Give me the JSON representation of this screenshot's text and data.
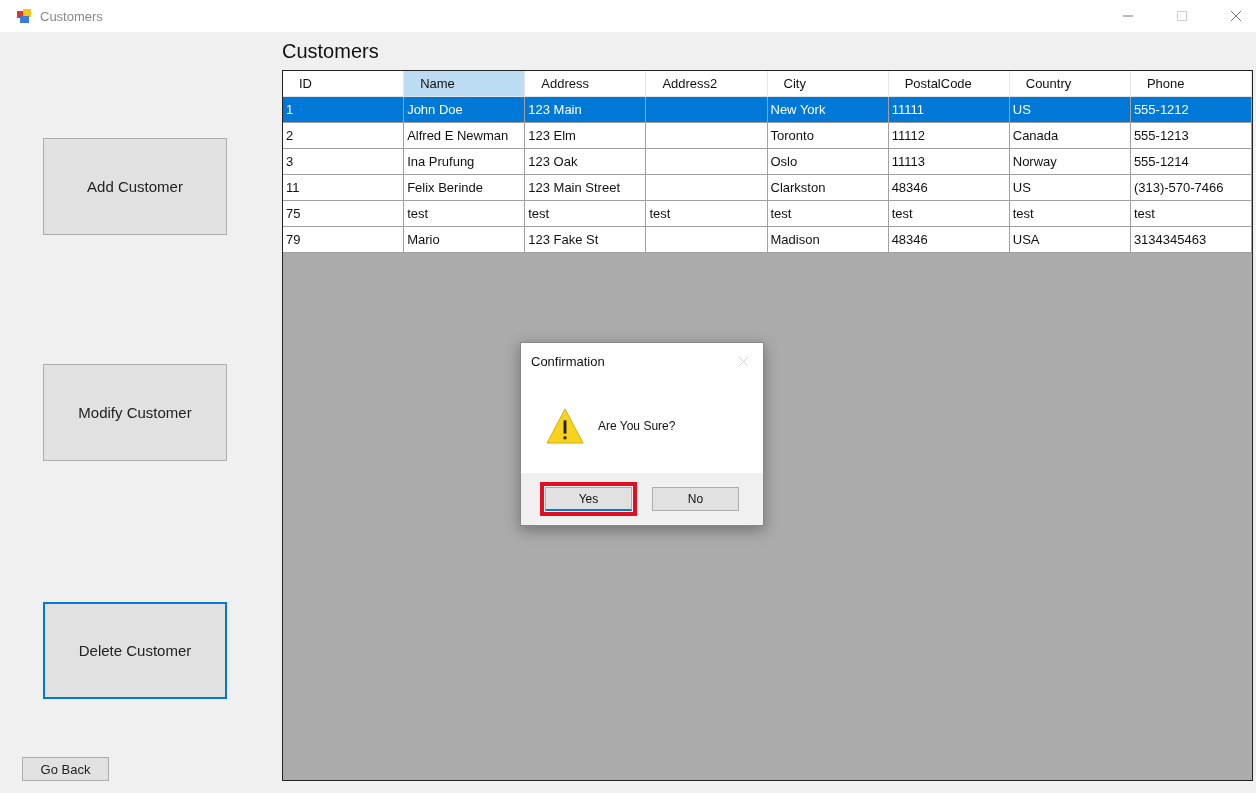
{
  "window": {
    "title": "Customers"
  },
  "actions": [
    {
      "label": "Add Customer",
      "focused": false
    },
    {
      "label": "Modify Customer",
      "focused": false
    },
    {
      "label": "Delete Customer",
      "focused": true
    }
  ],
  "back_button": {
    "label": "Go Back"
  },
  "heading": "Customers",
  "table": {
    "columns": [
      {
        "label": "ID",
        "selected": false
      },
      {
        "label": "Name",
        "selected": true
      },
      {
        "label": "Address",
        "selected": false
      },
      {
        "label": "Address2",
        "selected": false
      },
      {
        "label": "City",
        "selected": false
      },
      {
        "label": "PostalCode",
        "selected": false
      },
      {
        "label": "Country",
        "selected": false
      },
      {
        "label": "Phone",
        "selected": false
      }
    ],
    "rows": [
      {
        "selected": true,
        "cells": [
          "1",
          "John Doe",
          "123 Main",
          "",
          "New York",
          "11111",
          "US",
          "555-1212"
        ]
      },
      {
        "selected": false,
        "cells": [
          "2",
          "Alfred E Newman",
          "123 Elm",
          "",
          "Toronto",
          "11112",
          "Canada",
          "555-1213"
        ]
      },
      {
        "selected": false,
        "cells": [
          "3",
          "Ina Prufung",
          "123 Oak",
          "",
          "Oslo",
          "11113",
          "Norway",
          "555-1214"
        ]
      },
      {
        "selected": false,
        "cells": [
          "11",
          "Felix Berinde",
          "123 Main Street",
          "",
          "Clarkston",
          "48346",
          "US",
          "(313)-570-7466"
        ]
      },
      {
        "selected": false,
        "cells": [
          "75",
          "test",
          "test",
          "test",
          "test",
          "test",
          "test",
          "test"
        ]
      },
      {
        "selected": false,
        "cells": [
          "79",
          "Mario",
          "123 Fake St",
          "",
          "Madison",
          "48346",
          "USA",
          "3134345463"
        ]
      }
    ]
  },
  "dialog": {
    "title": "Confirmation",
    "message": "Are You Sure?",
    "buttons": [
      {
        "label": "Yes",
        "highlighted": true
      },
      {
        "label": "No",
        "highlighted": false
      }
    ]
  }
}
